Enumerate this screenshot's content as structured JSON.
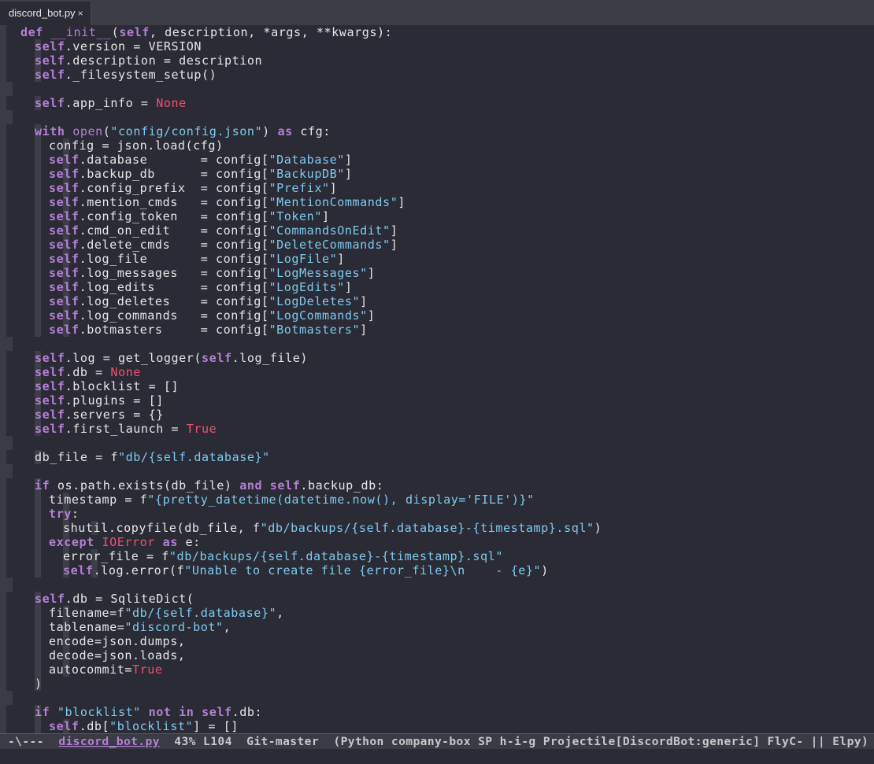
{
  "tab": {
    "title": "discord_bot.py",
    "close": "×"
  },
  "lines": [
    [
      [
        2,
        [
          [
            "k",
            "def"
          ],
          [
            "d",
            " "
          ],
          [
            "fn",
            "__init__"
          ],
          [
            "d",
            "("
          ],
          [
            "k",
            "self"
          ],
          [
            "d",
            ", description, *args, **kwargs):"
          ]
        ]
      ]
    ],
    [
      [
        4,
        [
          [
            "k",
            "self"
          ],
          [
            "d",
            ".version = VERSION"
          ]
        ]
      ]
    ],
    [
      [
        4,
        [
          [
            "k",
            "self"
          ],
          [
            "d",
            ".description = description"
          ]
        ]
      ]
    ],
    [
      [
        4,
        [
          [
            "k",
            "self"
          ],
          [
            "d",
            "._filesystem_setup()"
          ]
        ]
      ]
    ],
    [],
    [
      [
        4,
        [
          [
            "k",
            "self"
          ],
          [
            "d",
            ".app_info = "
          ],
          [
            "c",
            "None"
          ]
        ]
      ]
    ],
    [],
    [
      [
        4,
        [
          [
            "k",
            "with"
          ],
          [
            "d",
            " "
          ],
          [
            "fn",
            "open"
          ],
          [
            "d",
            "("
          ],
          [
            "s",
            "\"config/config.json\""
          ],
          [
            "d",
            ") "
          ],
          [
            "k",
            "as"
          ],
          [
            "d",
            " cfg:"
          ]
        ]
      ]
    ],
    [
      [
        6,
        [
          [
            "d",
            "config = json.load(cfg)"
          ]
        ]
      ]
    ],
    [
      [
        6,
        [
          [
            "k",
            "self"
          ],
          [
            "d",
            ".database       = config["
          ],
          [
            "s",
            "\"Database\""
          ],
          [
            "d",
            "]"
          ]
        ]
      ]
    ],
    [
      [
        6,
        [
          [
            "k",
            "self"
          ],
          [
            "d",
            ".backup_db      = config["
          ],
          [
            "s",
            "\"BackupDB\""
          ],
          [
            "d",
            "]"
          ]
        ]
      ]
    ],
    [
      [
        6,
        [
          [
            "k",
            "self"
          ],
          [
            "d",
            ".config_prefix  = config["
          ],
          [
            "s",
            "\"Prefix\""
          ],
          [
            "d",
            "]"
          ]
        ]
      ]
    ],
    [
      [
        6,
        [
          [
            "k",
            "self"
          ],
          [
            "d",
            ".mention_cmds   = config["
          ],
          [
            "s",
            "\"MentionCommands\""
          ],
          [
            "d",
            "]"
          ]
        ]
      ]
    ],
    [
      [
        6,
        [
          [
            "k",
            "self"
          ],
          [
            "d",
            ".config_token   = config["
          ],
          [
            "s",
            "\"Token\""
          ],
          [
            "d",
            "]"
          ]
        ]
      ]
    ],
    [
      [
        6,
        [
          [
            "k",
            "self"
          ],
          [
            "d",
            ".cmd_on_edit    = config["
          ],
          [
            "s",
            "\"CommandsOnEdit\""
          ],
          [
            "d",
            "]"
          ]
        ]
      ]
    ],
    [
      [
        6,
        [
          [
            "k",
            "self"
          ],
          [
            "d",
            ".delete_cmds    = config["
          ],
          [
            "s",
            "\"DeleteCommands\""
          ],
          [
            "d",
            "]"
          ]
        ]
      ]
    ],
    [
      [
        6,
        [
          [
            "k",
            "self"
          ],
          [
            "d",
            ".log_file       = config["
          ],
          [
            "s",
            "\"LogFile\""
          ],
          [
            "d",
            "]"
          ]
        ]
      ]
    ],
    [
      [
        6,
        [
          [
            "k",
            "self"
          ],
          [
            "d",
            ".log_messages   = config["
          ],
          [
            "s",
            "\"LogMessages\""
          ],
          [
            "d",
            "]"
          ]
        ]
      ]
    ],
    [
      [
        6,
        [
          [
            "k",
            "self"
          ],
          [
            "d",
            ".log_edits      = config["
          ],
          [
            "s",
            "\"LogEdits\""
          ],
          [
            "d",
            "]"
          ]
        ]
      ]
    ],
    [
      [
        6,
        [
          [
            "k",
            "self"
          ],
          [
            "d",
            ".log_deletes    = config["
          ],
          [
            "s",
            "\"LogDeletes\""
          ],
          [
            "d",
            "]"
          ]
        ]
      ]
    ],
    [
      [
        6,
        [
          [
            "k",
            "self"
          ],
          [
            "d",
            ".log_commands   = config["
          ],
          [
            "s",
            "\"LogCommands\""
          ],
          [
            "d",
            "]"
          ]
        ]
      ]
    ],
    [
      [
        6,
        [
          [
            "k",
            "self"
          ],
          [
            "d",
            ".botmasters     = config["
          ],
          [
            "s",
            "\"Botmasters\""
          ],
          [
            "d",
            "]"
          ]
        ]
      ]
    ],
    [],
    [
      [
        4,
        [
          [
            "k",
            "self"
          ],
          [
            "d",
            ".log = get_logger("
          ],
          [
            "k",
            "self"
          ],
          [
            "d",
            ".log_file)"
          ]
        ]
      ]
    ],
    [
      [
        4,
        [
          [
            "k",
            "self"
          ],
          [
            "d",
            ".db = "
          ],
          [
            "c",
            "None"
          ]
        ]
      ]
    ],
    [
      [
        4,
        [
          [
            "k",
            "self"
          ],
          [
            "d",
            ".blocklist = []"
          ]
        ]
      ]
    ],
    [
      [
        4,
        [
          [
            "k",
            "self"
          ],
          [
            "d",
            ".plugins = []"
          ]
        ]
      ]
    ],
    [
      [
        4,
        [
          [
            "k",
            "self"
          ],
          [
            "d",
            ".servers = {}"
          ]
        ]
      ]
    ],
    [
      [
        4,
        [
          [
            "k",
            "self"
          ],
          [
            "d",
            ".first_launch = "
          ],
          [
            "c",
            "True"
          ]
        ]
      ]
    ],
    [],
    [
      [
        4,
        [
          [
            "d",
            "db_file = f"
          ],
          [
            "s",
            "\"db/{self.database}\""
          ]
        ]
      ]
    ],
    [],
    [
      [
        4,
        [
          [
            "k",
            "if"
          ],
          [
            "d",
            " os.path.exists(db_file) "
          ],
          [
            "k",
            "and"
          ],
          [
            "d",
            " "
          ],
          [
            "k",
            "self"
          ],
          [
            "d",
            ".backup_db:"
          ]
        ]
      ]
    ],
    [
      [
        6,
        [
          [
            "d",
            "timestamp = f"
          ],
          [
            "s",
            "\"{pretty_datetime(datetime.now(), display='FILE')}\""
          ]
        ]
      ]
    ],
    [
      [
        6,
        [
          [
            "k",
            "try"
          ],
          [
            "d",
            ":"
          ]
        ]
      ]
    ],
    [
      [
        8,
        [
          [
            "d",
            "shutil.copyfile(db_file, f"
          ],
          [
            "s",
            "\"db/backups/{self.database}-{timestamp}.sql\""
          ],
          [
            "d",
            ")"
          ]
        ]
      ]
    ],
    [
      [
        6,
        [
          [
            "k",
            "except"
          ],
          [
            "d",
            " "
          ],
          [
            "c",
            "IOError"
          ],
          [
            "d",
            " "
          ],
          [
            "k",
            "as"
          ],
          [
            "d",
            " e:"
          ]
        ]
      ]
    ],
    [
      [
        8,
        [
          [
            "d",
            "error_file = f"
          ],
          [
            "s",
            "\"db/backups/{self.database}-{timestamp}.sql\""
          ]
        ]
      ]
    ],
    [
      [
        8,
        [
          [
            "k",
            "self"
          ],
          [
            "d",
            ".log.error(f"
          ],
          [
            "s",
            "\"Unable to create file {error_file}\\n    - {e}\""
          ],
          [
            "d",
            ")"
          ]
        ]
      ]
    ],
    [],
    [
      [
        4,
        [
          [
            "k",
            "self"
          ],
          [
            "d",
            ".db = SqliteDict("
          ]
        ]
      ]
    ],
    [
      [
        6,
        [
          [
            "d",
            "filename=f"
          ],
          [
            "s",
            "\"db/{self.database}\""
          ],
          [
            "d",
            ","
          ]
        ]
      ]
    ],
    [
      [
        6,
        [
          [
            "d",
            "tablename="
          ],
          [
            "s",
            "\"discord-bot\""
          ],
          [
            "d",
            ","
          ]
        ]
      ]
    ],
    [
      [
        6,
        [
          [
            "d",
            "encode=json.dumps,"
          ]
        ]
      ]
    ],
    [
      [
        6,
        [
          [
            "d",
            "decode=json.loads,"
          ]
        ]
      ]
    ],
    [
      [
        6,
        [
          [
            "d",
            "autocommit="
          ],
          [
            "c",
            "True"
          ]
        ]
      ]
    ],
    [
      [
        4,
        [
          [
            "d",
            ")"
          ]
        ]
      ]
    ],
    [],
    [
      [
        4,
        [
          [
            "k",
            "if"
          ],
          [
            "d",
            " "
          ],
          [
            "s",
            "\"blocklist\""
          ],
          [
            "d",
            " "
          ],
          [
            "k",
            "not"
          ],
          [
            "d",
            " "
          ],
          [
            "k",
            "in"
          ],
          [
            "d",
            " "
          ],
          [
            "k",
            "self"
          ],
          [
            "d",
            ".db:"
          ]
        ]
      ]
    ],
    [
      [
        6,
        [
          [
            "k",
            "self"
          ],
          [
            "d",
            ".db["
          ],
          [
            "s",
            "\"blocklist\""
          ],
          [
            "d",
            "] = []"
          ]
        ]
      ]
    ]
  ],
  "modeline": {
    "prefix": "-\\---  ",
    "buffer": "discord_bot.py",
    "rest": "  43% L104  Git-master  (Python company-box SP h-i-g Projectile[DiscordBot:generic] FlyC- || Elpy)"
  },
  "colors": {
    "background": "#2a2b35",
    "keyword": "#b480d6",
    "string": "#7ecaf0",
    "constant": "#f0506e",
    "text": "#e6e6e6"
  }
}
